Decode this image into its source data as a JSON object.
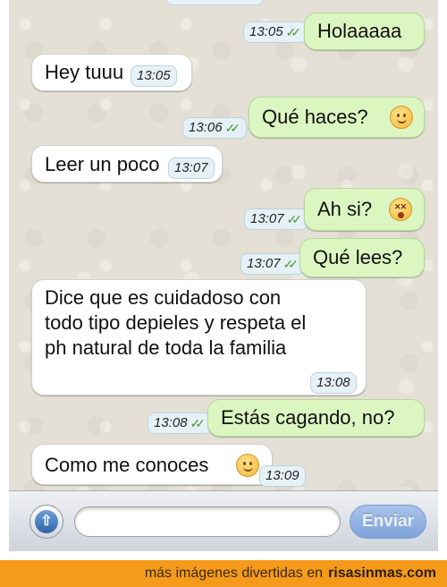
{
  "messages": [
    {
      "dir": "out",
      "text": "Holaaaaa",
      "time": "13:05"
    },
    {
      "dir": "in",
      "text": "Hey tuuu",
      "time": "13:05"
    },
    {
      "dir": "out",
      "text": "Qué haces?",
      "time": "13:06",
      "emoji": "smile-emoji-icon"
    },
    {
      "dir": "in",
      "text": "Leer un poco",
      "time": "13:07"
    },
    {
      "dir": "out",
      "text": "Ah si?",
      "time": "13:07",
      "emoji": "dizzy-face-emoji-icon"
    },
    {
      "dir": "out",
      "text": "Qué lees?",
      "time": "13:07"
    },
    {
      "dir": "in",
      "text": "Dice que es cuidadoso con todo tipo depieles y respeta el ph natural de toda la familia",
      "time": "13:08"
    },
    {
      "dir": "out",
      "text": "Estás cagando, no?",
      "time": "13:08"
    },
    {
      "dir": "in",
      "text": "Como me conoces",
      "time": "13:09",
      "emoji": "blush-emoji-icon"
    }
  ],
  "composer": {
    "input_value": "",
    "send_label": "Enviar",
    "attach_icon": "camera-arrow-icon"
  },
  "footer": {
    "prefix": "más imágenes divertidas en",
    "brand": "risasinmas.com"
  },
  "colors": {
    "outgoing_bubble": "#dcf6c2",
    "incoming_bubble": "#ffffff",
    "timestamp_bg": "#e6f1f7",
    "read_ticks": "#4a9a35",
    "footer_bg": "#f59a1b",
    "send_button": "#7ea3da"
  }
}
